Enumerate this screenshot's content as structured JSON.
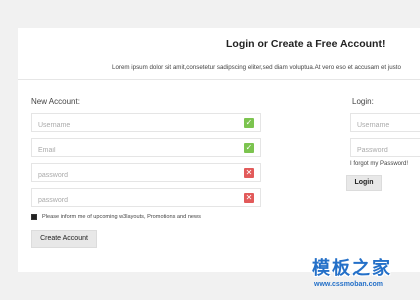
{
  "header": {
    "title": "Login or Create a Free Account!",
    "subtitle": "Lorem ipsum dolor sit amit,consetetur sadipscing eliter,sed diam voluptua.At vero eso et accusam et justo"
  },
  "new_account": {
    "heading": "New Account:",
    "fields": [
      {
        "placeholder": "Username",
        "status": "valid"
      },
      {
        "placeholder": "Email",
        "status": "valid"
      },
      {
        "placeholder": "password",
        "status": "invalid"
      },
      {
        "placeholder": "password",
        "status": "invalid"
      }
    ],
    "checkbox_label": "Please inform me of upcoming w3layouts, Promotions and news",
    "checkbox_checked": true,
    "submit_label": "Create Account"
  },
  "login": {
    "heading": "Login:",
    "username_placeholder": "Username",
    "password_placeholder": "Password",
    "forgot_label": "I forgot my Password!",
    "submit_label": "Login"
  },
  "watermark": {
    "main": "模板之家",
    "url": "www.cssmoban.com"
  },
  "colors": {
    "valid": "#7cc44f",
    "invalid": "#e25a5a",
    "brand": "#2470c8"
  }
}
